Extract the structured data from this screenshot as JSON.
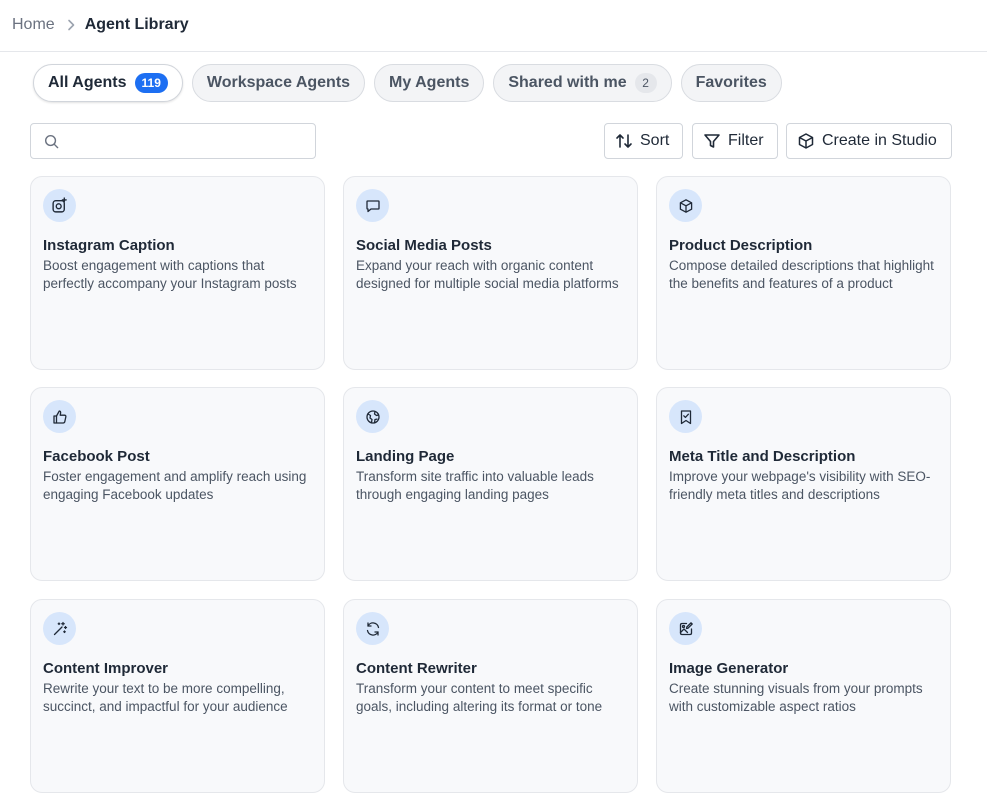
{
  "breadcrumb": {
    "home": "Home",
    "current": "Agent Library"
  },
  "tabs": [
    {
      "label": "All Agents",
      "badge": "119",
      "active": true
    },
    {
      "label": "Workspace Agents"
    },
    {
      "label": "My Agents"
    },
    {
      "label": "Shared with me",
      "badge": "2"
    },
    {
      "label": "Favorites"
    }
  ],
  "search": {
    "placeholder": "",
    "value": ""
  },
  "toolbar": {
    "sort_label": "Sort",
    "filter_label": "Filter",
    "create_label": "Create in Studio"
  },
  "colors": {
    "accent": "#1d6ff2",
    "icon_circle": "#d7e6fb",
    "card_bg": "#f8f9fb"
  },
  "agents": [
    {
      "title": "Instagram Caption",
      "description": "Boost engagement with captions that perfectly accompany your Instagram posts",
      "icon": "instagram-icon"
    },
    {
      "title": "Social Media Posts",
      "description": "Expand your reach with organic content designed for multiple social media platforms",
      "icon": "chat-bubble-icon"
    },
    {
      "title": "Product Description",
      "description": "Compose detailed descriptions that highlight the benefits and features of a product",
      "icon": "box-icon"
    },
    {
      "title": "Facebook Post",
      "description": "Foster engagement and amplify reach using engaging Facebook updates",
      "icon": "thumbs-up-icon"
    },
    {
      "title": "Landing Page",
      "description": "Transform site traffic into valuable leads through engaging landing pages",
      "icon": "globe-icon"
    },
    {
      "title": "Meta Title and Description",
      "description": "Improve your webpage's visibility with SEO-friendly meta titles and descriptions",
      "icon": "bookmark-check-icon"
    },
    {
      "title": "Content Improver",
      "description": "Rewrite your text to be more compelling, succinct, and impactful for your audience",
      "icon": "magic-wand-icon"
    },
    {
      "title": "Content Rewriter",
      "description": "Transform your content to meet specific goals, including altering its format or tone",
      "icon": "refresh-icon"
    },
    {
      "title": "Image Generator",
      "description": "Create stunning visuals from your prompts with customizable aspect ratios",
      "icon": "image-edit-icon"
    }
  ]
}
